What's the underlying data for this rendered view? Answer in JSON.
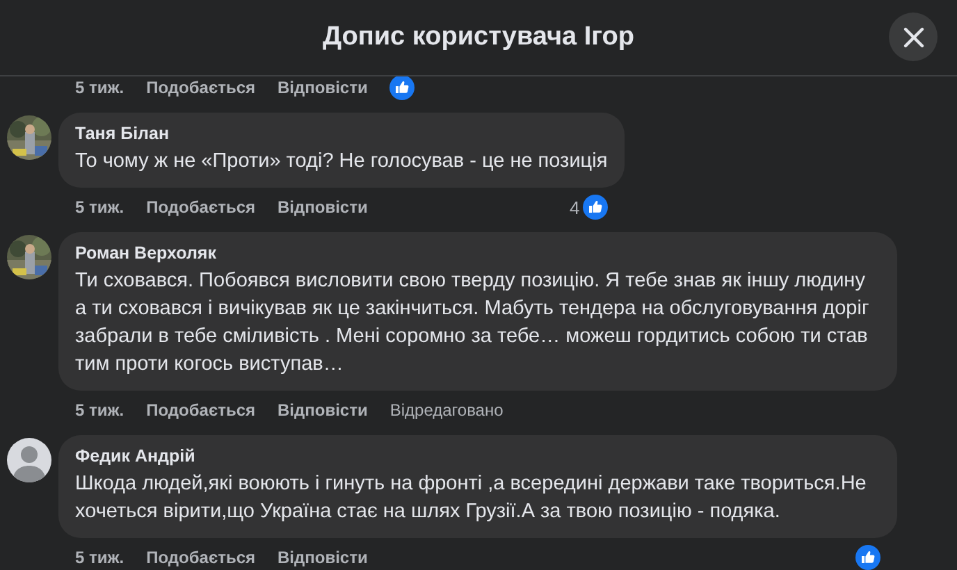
{
  "header": {
    "title": "Допис користувача Ігор"
  },
  "comments": [
    {
      "actions": [
        "5 тиж.",
        "Подобається",
        "Відповісти"
      ],
      "reaction": {
        "kind": "inline"
      }
    },
    {
      "author": "Таня Білан",
      "avatar": {
        "kind": "picture"
      },
      "text": "То чому ж не «Проти» тоді? Не голосував - це не позиція",
      "actions": [
        "5 тиж.",
        "Подобається",
        "Відповісти"
      ],
      "reaction": {
        "kind": "end",
        "count": "4"
      }
    },
    {
      "author": "Роман Верхоляк",
      "avatar": {
        "kind": "picture"
      },
      "text": "Ти сховався. Побоявся висловити свою тверду позицію. Я тебе знав як іншу людину а ти сховався і вичікував як це закінчиться. Мабуть тендера на обслуговування доріг забрали в тебе сміливість . Мені соромно за тебе… можеш гордитись собою ти став тим проти когось виступав…",
      "actions": [
        "5 тиж.",
        "Подобається",
        "Відповісти"
      ],
      "edited": "Відредаговано"
    },
    {
      "author": "Федик Андрій",
      "avatar": {
        "kind": "silhouette"
      },
      "text": "Шкода людей,які воюють і гинуть на фронті ,а всередині держави таке твориться.Не хочеться вірити,що Україна стає на шлях Грузії.А за твою позицію - подяка.",
      "actions": [
        "5 тиж.",
        "Подобається",
        "Відповісти"
      ],
      "reaction": {
        "kind": "end"
      }
    }
  ]
}
